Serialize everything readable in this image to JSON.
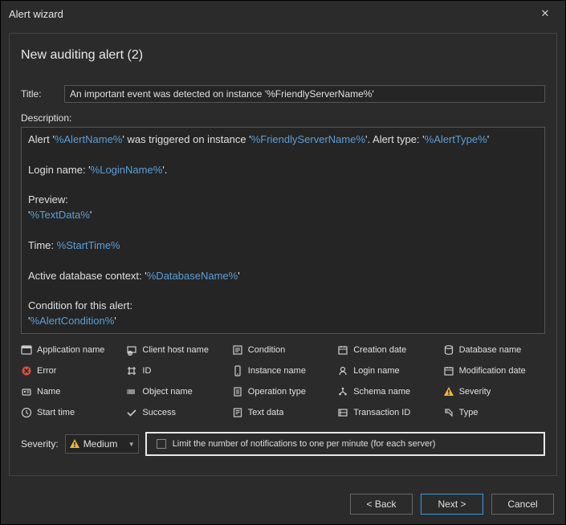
{
  "window": {
    "title": "Alert wizard"
  },
  "step": {
    "title": "New auditing alert (2)"
  },
  "form": {
    "title_label": "Title:",
    "title_value": "An important event was detected on instance '%FriendlyServerName%'",
    "desc_label": "Description:",
    "desc_parts": {
      "l1a": "Alert '",
      "l1b": "%AlertName%",
      "l1c": "' was triggered on instance '",
      "l1d": "%FriendlyServerName%",
      "l1e": "'. Alert type: '",
      "l1f": "%AlertType%",
      "l1g": "'",
      "l2a": "Login name: '",
      "l2b": "%LoginName%",
      "l2c": "'.",
      "l3a": "Preview:",
      "l3b": "'",
      "l3c": "%TextData%",
      "l3d": "'",
      "l4a": "Time: ",
      "l4b": "%StartTime%",
      "l5a": "Active database context: '",
      "l5b": "%DatabaseName%",
      "l5c": "'",
      "l6a": "Condition for this alert:",
      "l6b": "'",
      "l6c": "%AlertCondition%",
      "l6d": "'"
    }
  },
  "placeholders": [
    {
      "icon": "app",
      "label": "Application name"
    },
    {
      "icon": "host",
      "label": "Client host name"
    },
    {
      "icon": "condition",
      "label": "Condition"
    },
    {
      "icon": "date",
      "label": "Creation date"
    },
    {
      "icon": "db",
      "label": "Database name"
    },
    {
      "icon": "error",
      "label": "Error"
    },
    {
      "icon": "id",
      "label": "ID"
    },
    {
      "icon": "instance",
      "label": "Instance name"
    },
    {
      "icon": "login",
      "label": "Login name"
    },
    {
      "icon": "date",
      "label": "Modification date"
    },
    {
      "icon": "name",
      "label": "Name"
    },
    {
      "icon": "object",
      "label": "Object name"
    },
    {
      "icon": "optype",
      "label": "Operation type"
    },
    {
      "icon": "schema",
      "label": "Schema name"
    },
    {
      "icon": "severity",
      "label": "Severity"
    },
    {
      "icon": "clock",
      "label": "Start time"
    },
    {
      "icon": "check",
      "label": "Success"
    },
    {
      "icon": "text",
      "label": "Text data"
    },
    {
      "icon": "txn",
      "label": "Transaction ID"
    },
    {
      "icon": "type",
      "label": "Type"
    }
  ],
  "severity": {
    "label": "Severity:",
    "selected": "Medium"
  },
  "limit": {
    "label": "Limit the number of notifications to one per minute (for each server)",
    "checked": false
  },
  "buttons": {
    "back": "< Back",
    "next": "Next >",
    "cancel": "Cancel"
  }
}
